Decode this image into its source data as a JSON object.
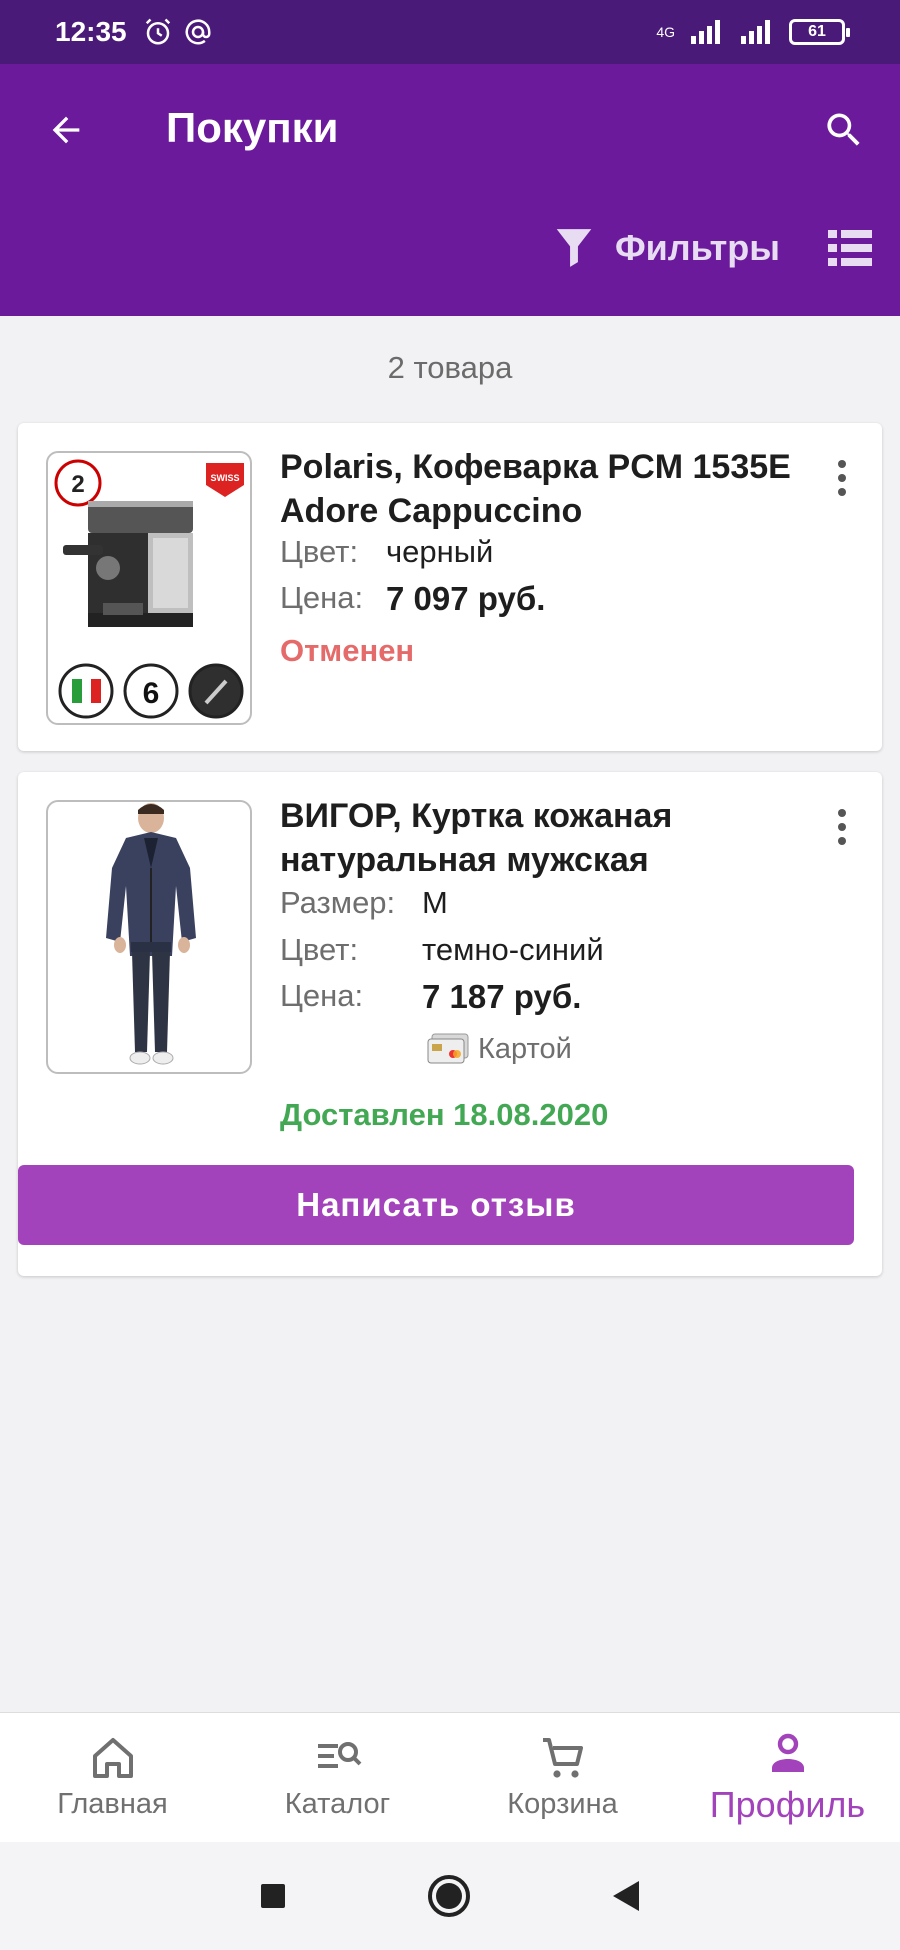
{
  "status_bar": {
    "time": "12:35",
    "network": "4G",
    "battery": "61"
  },
  "header": {
    "title": "Покупки",
    "filters_label": "Фильтры"
  },
  "summary": {
    "count_text": "2 товара"
  },
  "orders": [
    {
      "title": "Polaris, Кофеварка PCM 1535E Adore Cappuccino",
      "color_label": "Цвет:",
      "color_value": "черный",
      "price_label": "Цена:",
      "price_value": "7 097 руб.",
      "status": "Отменен",
      "thumb_badges": {
        "warranty": "2",
        "brand": "SWISS",
        "pressure": "6"
      }
    },
    {
      "title": "ВИГОР, Куртка кожаная натуральная мужская",
      "size_label": "Размер:",
      "size_value": "M",
      "color_label": "Цвет:",
      "color_value": "темно-синий",
      "price_label": "Цена:",
      "price_value": "7 187 руб.",
      "payment": "Картой",
      "status": "Доставлен 18.08.2020",
      "review_button": "Написать отзыв"
    }
  ],
  "bottom_nav": [
    {
      "label": "Главная",
      "icon": "home-icon"
    },
    {
      "label": "Каталог",
      "icon": "catalog-search-icon"
    },
    {
      "label": "Корзина",
      "icon": "cart-icon"
    },
    {
      "label": "Профиль",
      "icon": "profile-icon",
      "active": true
    }
  ],
  "colors": {
    "primary": "#6b1a9b",
    "accent": "#a343bb",
    "cancelled": "#e56a6a",
    "delivered": "#43a853"
  }
}
